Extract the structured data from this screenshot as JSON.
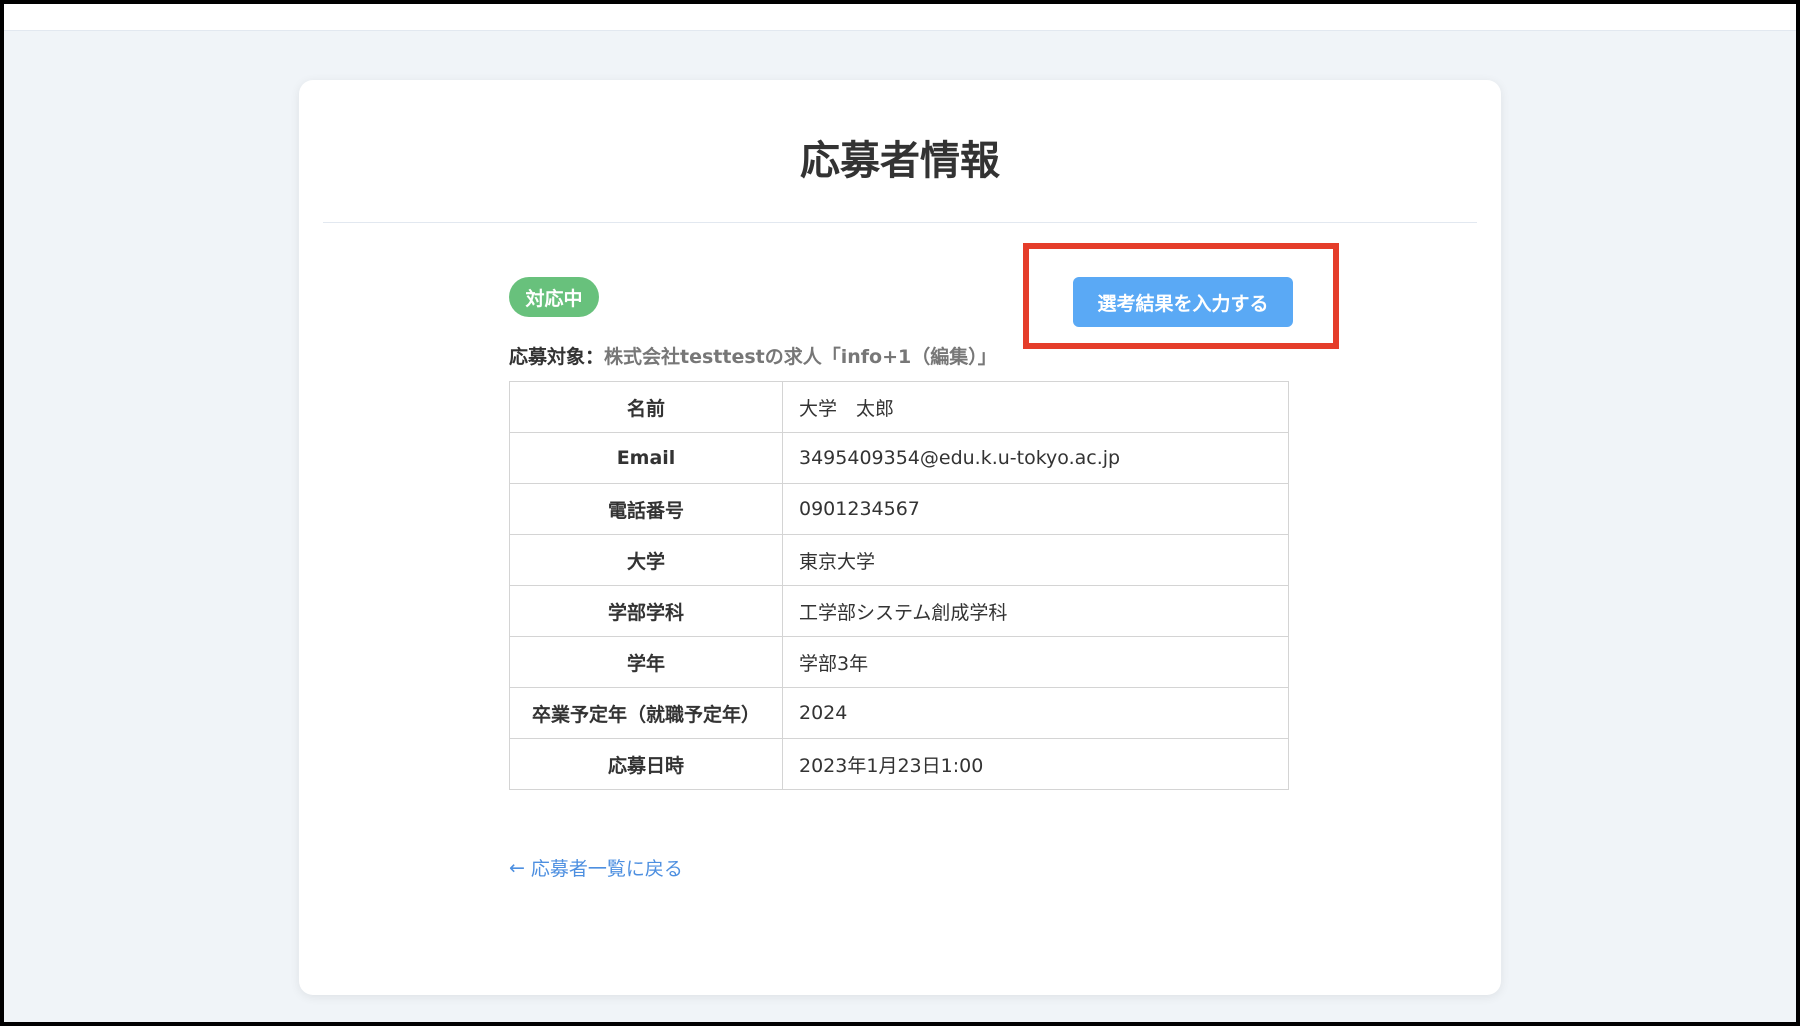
{
  "header": {
    "title": "応募者情報"
  },
  "status": {
    "badge": "対応中",
    "color": "#68c17c"
  },
  "actions": {
    "enter_result_label": "選考結果を入力する",
    "color": "#5aa9f5"
  },
  "target": {
    "label": "応募対象：",
    "value": "株式会社testtestの求人「info+1（編集）」"
  },
  "applicant_table": {
    "rows": [
      {
        "label": "名前",
        "value": "大学　太郎"
      },
      {
        "label": "Email",
        "value": "3495409354@edu.k.u-tokyo.ac.jp"
      },
      {
        "label": "電話番号",
        "value": "0901234567"
      },
      {
        "label": "大学",
        "value": "東京大学"
      },
      {
        "label": "学部学科",
        "value": "工学部システム創成学科"
      },
      {
        "label": "学年",
        "value": "学部3年"
      },
      {
        "label": "卒業予定年（就職予定年）",
        "value": "2024"
      },
      {
        "label": "応募日時",
        "value": "2023年1月23日1:00"
      }
    ]
  },
  "navigation": {
    "back_label": "応募者一覧に戻る",
    "back_icon": "arrow-left-icon"
  },
  "annotation": {
    "highlight_color": "#e53d2a"
  }
}
